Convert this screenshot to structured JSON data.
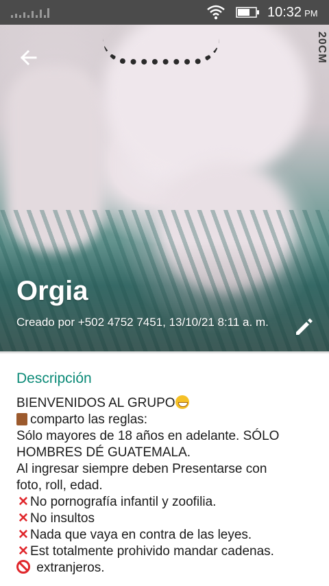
{
  "status_bar": {
    "time": "10:32",
    "ampm": "PM",
    "icons": [
      "signal-icon",
      "wifi-icon",
      "battery-icon"
    ]
  },
  "hero": {
    "watermark": "20CM",
    "group_name": "Orgia",
    "created_by": "Creado por +502 4752 7451, 13/10/21 8:11 a. m."
  },
  "description": {
    "title": "Descripción",
    "lines": [
      {
        "prefix": "",
        "text": "BIENVENIDOS  AL GRUPO",
        "suffix": "grin-emoji"
      },
      {
        "prefix": "scroll-emoji",
        "text": "comparto las reglas:"
      },
      {
        "prefix": "",
        "text": "Sólo mayores de 18 años en adelante. SÓLO"
      },
      {
        "prefix": "",
        "text": "HOMBRES DÉ  GUATEMALA."
      },
      {
        "prefix": "",
        "text": "Al ingresar siempre deben Presentarse con"
      },
      {
        "prefix": "",
        "text": "foto, roll, edad."
      },
      {
        "prefix": "x-emoji",
        "text": "No pornografía infantil y zoofilia."
      },
      {
        "prefix": "x-emoji",
        "text": "No insultos"
      },
      {
        "prefix": "x-emoji",
        "text": "Nada que vaya en contra de las leyes."
      },
      {
        "prefix": "x-emoji",
        "text": "Est totalmente prohivido mandar cadenas."
      },
      {
        "prefix": "no-entry-emoji",
        "text": " extranjeros."
      }
    ]
  },
  "colors": {
    "accent": "#0b8a77",
    "status_bar": "#4b4b4b",
    "x_mark": "#e0262b"
  }
}
